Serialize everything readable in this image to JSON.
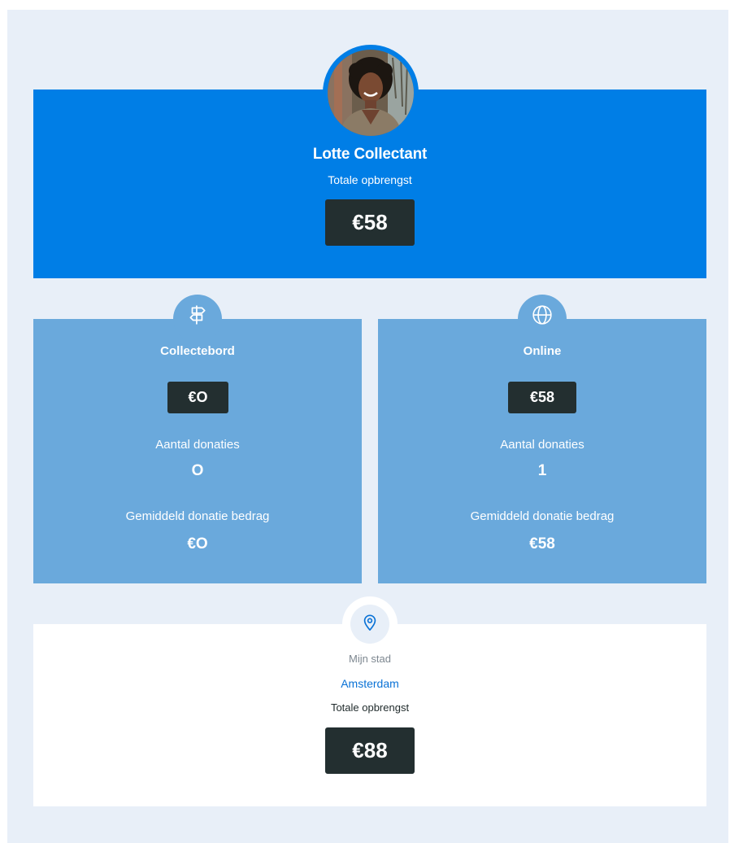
{
  "profile": {
    "name": "Lotte Collectant",
    "total_label": "Totale opbrengst",
    "total_amount": "€58"
  },
  "channels": [
    {
      "icon": "signpost-icon",
      "title": "Collectebord",
      "amount": "€O",
      "donations_label": "Aantal donaties",
      "donations_count": "O",
      "avg_label": "Gemiddeld donatie bedrag",
      "avg_amount": "€O"
    },
    {
      "icon": "globe-icon",
      "title": "Online",
      "amount": "€58",
      "donations_label": "Aantal donaties",
      "donations_count": "1",
      "avg_label": "Gemiddeld donatie bedrag",
      "avg_amount": "€58"
    }
  ],
  "city": {
    "icon": "location-pin-icon",
    "label": "Mijn stad",
    "name": "Amsterdam",
    "total_label": "Totale opbrengst",
    "total_amount": "€88"
  },
  "colors": {
    "hero": "#007ee6",
    "card": "#6aa9dc",
    "badge": "#232f30",
    "page": "#e8eff8",
    "link": "#0a72d6"
  }
}
